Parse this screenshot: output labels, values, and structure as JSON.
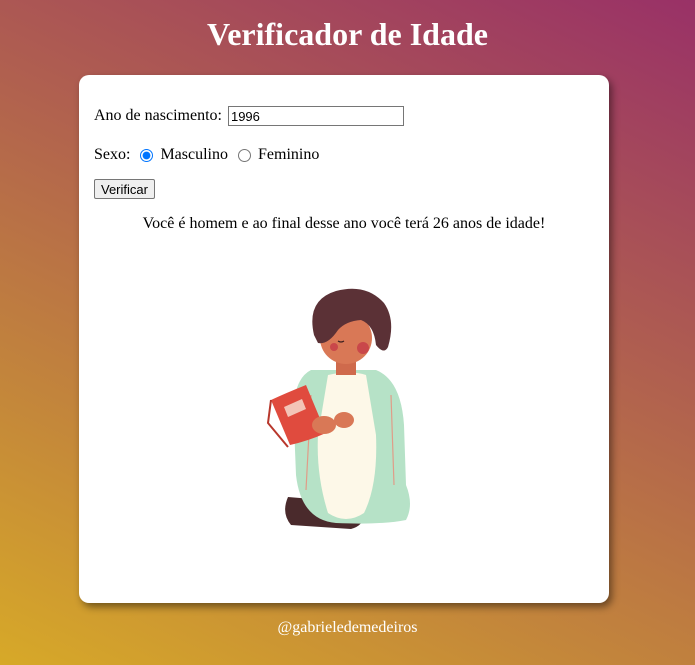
{
  "header": {
    "title": "Verificador de Idade"
  },
  "form": {
    "year_label": "Ano de nascimento:",
    "year_value": "1996",
    "sex_label": "Sexo:",
    "options": [
      {
        "label": "Masculino",
        "checked": true
      },
      {
        "label": "Feminino",
        "checked": false
      }
    ],
    "submit_label": "Verificar"
  },
  "result": {
    "message": "Você é homem e ao final desse ano você terá 26 anos de idade!"
  },
  "illustration": {
    "icon": "boy-reading-book-illustration"
  },
  "footer": {
    "credit": "@gabrieledemedeiros"
  }
}
